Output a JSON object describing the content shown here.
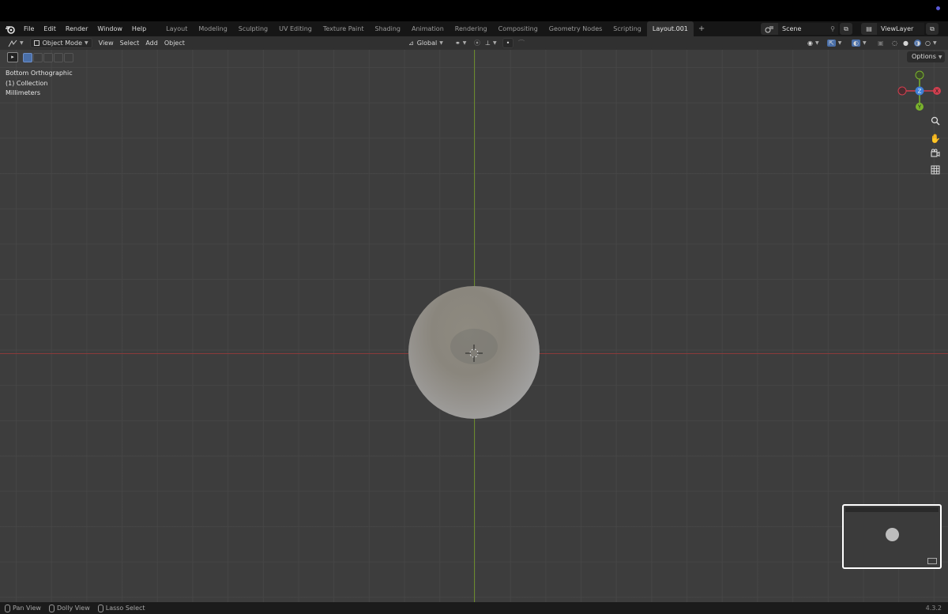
{
  "menu": {
    "items": [
      "File",
      "Edit",
      "Render",
      "Window",
      "Help"
    ]
  },
  "tabs": [
    "Layout",
    "Modeling",
    "Sculpting",
    "UV Editing",
    "Texture Paint",
    "Shading",
    "Animation",
    "Rendering",
    "Compositing",
    "Geometry Nodes",
    "Scripting",
    "Layout.001"
  ],
  "active_tab": "Layout.001",
  "scene": {
    "name": "Scene"
  },
  "view_layer": {
    "name": "ViewLayer"
  },
  "header": {
    "mode": "Object Mode",
    "menus": [
      "View",
      "Select",
      "Add",
      "Object"
    ],
    "transform_orientation": "Global"
  },
  "viewport": {
    "view_name": "Bottom Orthographic",
    "collection": "(1) Collection",
    "units": "Millimeters",
    "options_label": "Options",
    "gizmo": {
      "x_label": "X",
      "y_label": "Y",
      "z_label": "Z"
    }
  },
  "status": {
    "items": [
      "Pan View",
      "Dolly View",
      "Lasso Select"
    ],
    "version": "4.3.2"
  },
  "colors": {
    "axis_x": "#8a3a3a",
    "axis_y": "#6b8a2b",
    "gizmo_x": "#d33f4f",
    "gizmo_y": "#7ab32d",
    "gizmo_z": "#3f7fd6",
    "selection_accent": "#4a6fa8"
  }
}
